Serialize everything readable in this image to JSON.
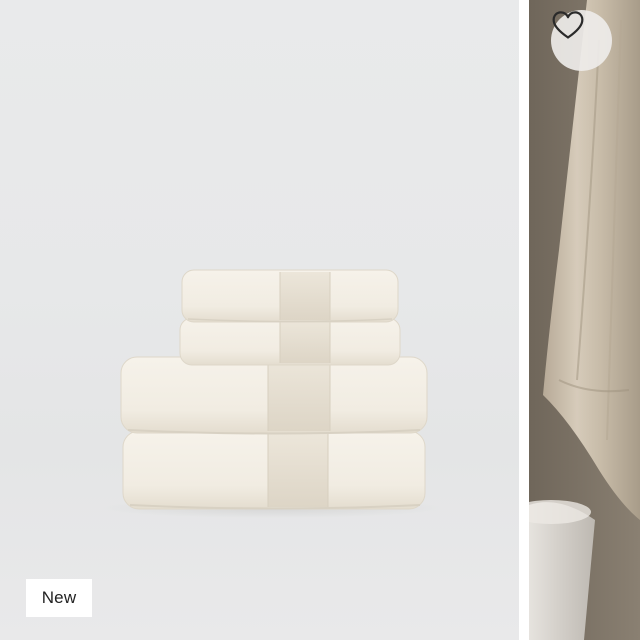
{
  "product_card": {
    "badge_label": "New",
    "wishlist": {
      "icon": "heart-outline-icon"
    },
    "main_image": {
      "subject": "towel-stack",
      "alt": "towel-stack"
    },
    "secondary_image": {
      "subject": "hanging-towel",
      "alt": "hanging-towel"
    }
  },
  "colors": {
    "background": "#e8e9ea",
    "towel": "#f3efe6",
    "towel_shadow": "#e3ddd0",
    "side_image": "#8f8576",
    "badge_bg": "#ffffff",
    "badge_text": "#222222"
  }
}
